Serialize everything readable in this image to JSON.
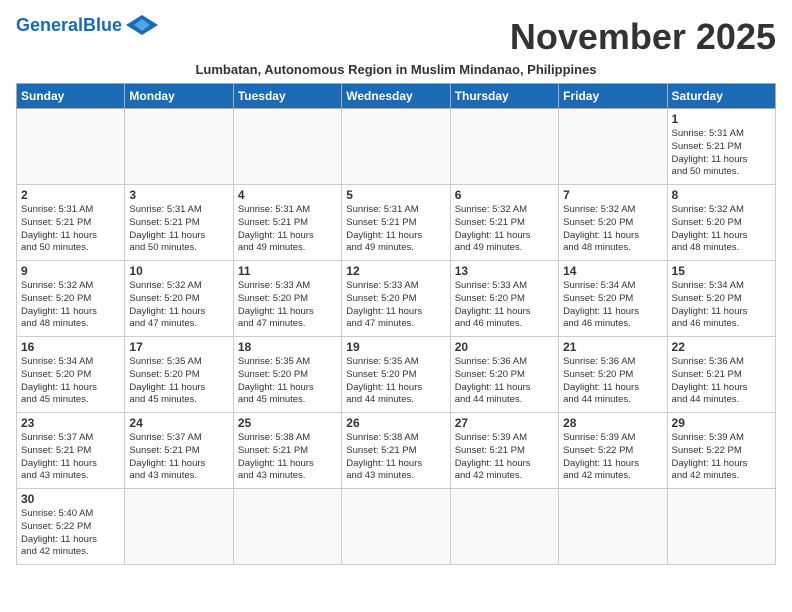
{
  "header": {
    "logo_general": "General",
    "logo_blue": "Blue",
    "month_title": "November 2025",
    "subtitle": "Lumbatan, Autonomous Region in Muslim Mindanao, Philippines"
  },
  "days_of_week": [
    "Sunday",
    "Monday",
    "Tuesday",
    "Wednesday",
    "Thursday",
    "Friday",
    "Saturday"
  ],
  "weeks": [
    [
      {
        "day": "",
        "info": ""
      },
      {
        "day": "",
        "info": ""
      },
      {
        "day": "",
        "info": ""
      },
      {
        "day": "",
        "info": ""
      },
      {
        "day": "",
        "info": ""
      },
      {
        "day": "",
        "info": ""
      },
      {
        "day": "1",
        "info": "Sunrise: 5:31 AM\nSunset: 5:21 PM\nDaylight: 11 hours\nand 50 minutes."
      }
    ],
    [
      {
        "day": "2",
        "info": "Sunrise: 5:31 AM\nSunset: 5:21 PM\nDaylight: 11 hours\nand 50 minutes."
      },
      {
        "day": "3",
        "info": "Sunrise: 5:31 AM\nSunset: 5:21 PM\nDaylight: 11 hours\nand 50 minutes."
      },
      {
        "day": "4",
        "info": "Sunrise: 5:31 AM\nSunset: 5:21 PM\nDaylight: 11 hours\nand 49 minutes."
      },
      {
        "day": "5",
        "info": "Sunrise: 5:31 AM\nSunset: 5:21 PM\nDaylight: 11 hours\nand 49 minutes."
      },
      {
        "day": "6",
        "info": "Sunrise: 5:32 AM\nSunset: 5:21 PM\nDaylight: 11 hours\nand 49 minutes."
      },
      {
        "day": "7",
        "info": "Sunrise: 5:32 AM\nSunset: 5:20 PM\nDaylight: 11 hours\nand 48 minutes."
      },
      {
        "day": "8",
        "info": "Sunrise: 5:32 AM\nSunset: 5:20 PM\nDaylight: 11 hours\nand 48 minutes."
      }
    ],
    [
      {
        "day": "9",
        "info": "Sunrise: 5:32 AM\nSunset: 5:20 PM\nDaylight: 11 hours\nand 48 minutes."
      },
      {
        "day": "10",
        "info": "Sunrise: 5:32 AM\nSunset: 5:20 PM\nDaylight: 11 hours\nand 47 minutes."
      },
      {
        "day": "11",
        "info": "Sunrise: 5:33 AM\nSunset: 5:20 PM\nDaylight: 11 hours\nand 47 minutes."
      },
      {
        "day": "12",
        "info": "Sunrise: 5:33 AM\nSunset: 5:20 PM\nDaylight: 11 hours\nand 47 minutes."
      },
      {
        "day": "13",
        "info": "Sunrise: 5:33 AM\nSunset: 5:20 PM\nDaylight: 11 hours\nand 46 minutes."
      },
      {
        "day": "14",
        "info": "Sunrise: 5:34 AM\nSunset: 5:20 PM\nDaylight: 11 hours\nand 46 minutes."
      },
      {
        "day": "15",
        "info": "Sunrise: 5:34 AM\nSunset: 5:20 PM\nDaylight: 11 hours\nand 46 minutes."
      }
    ],
    [
      {
        "day": "16",
        "info": "Sunrise: 5:34 AM\nSunset: 5:20 PM\nDaylight: 11 hours\nand 45 minutes."
      },
      {
        "day": "17",
        "info": "Sunrise: 5:35 AM\nSunset: 5:20 PM\nDaylight: 11 hours\nand 45 minutes."
      },
      {
        "day": "18",
        "info": "Sunrise: 5:35 AM\nSunset: 5:20 PM\nDaylight: 11 hours\nand 45 minutes."
      },
      {
        "day": "19",
        "info": "Sunrise: 5:35 AM\nSunset: 5:20 PM\nDaylight: 11 hours\nand 44 minutes."
      },
      {
        "day": "20",
        "info": "Sunrise: 5:36 AM\nSunset: 5:20 PM\nDaylight: 11 hours\nand 44 minutes."
      },
      {
        "day": "21",
        "info": "Sunrise: 5:36 AM\nSunset: 5:20 PM\nDaylight: 11 hours\nand 44 minutes."
      },
      {
        "day": "22",
        "info": "Sunrise: 5:36 AM\nSunset: 5:21 PM\nDaylight: 11 hours\nand 44 minutes."
      }
    ],
    [
      {
        "day": "23",
        "info": "Sunrise: 5:37 AM\nSunset: 5:21 PM\nDaylight: 11 hours\nand 43 minutes."
      },
      {
        "day": "24",
        "info": "Sunrise: 5:37 AM\nSunset: 5:21 PM\nDaylight: 11 hours\nand 43 minutes."
      },
      {
        "day": "25",
        "info": "Sunrise: 5:38 AM\nSunset: 5:21 PM\nDaylight: 11 hours\nand 43 minutes."
      },
      {
        "day": "26",
        "info": "Sunrise: 5:38 AM\nSunset: 5:21 PM\nDaylight: 11 hours\nand 43 minutes."
      },
      {
        "day": "27",
        "info": "Sunrise: 5:39 AM\nSunset: 5:21 PM\nDaylight: 11 hours\nand 42 minutes."
      },
      {
        "day": "28",
        "info": "Sunrise: 5:39 AM\nSunset: 5:22 PM\nDaylight: 11 hours\nand 42 minutes."
      },
      {
        "day": "29",
        "info": "Sunrise: 5:39 AM\nSunset: 5:22 PM\nDaylight: 11 hours\nand 42 minutes."
      }
    ],
    [
      {
        "day": "30",
        "info": "Sunrise: 5:40 AM\nSunset: 5:22 PM\nDaylight: 11 hours\nand 42 minutes."
      },
      {
        "day": "",
        "info": ""
      },
      {
        "day": "",
        "info": ""
      },
      {
        "day": "",
        "info": ""
      },
      {
        "day": "",
        "info": ""
      },
      {
        "day": "",
        "info": ""
      },
      {
        "day": "",
        "info": ""
      }
    ]
  ]
}
